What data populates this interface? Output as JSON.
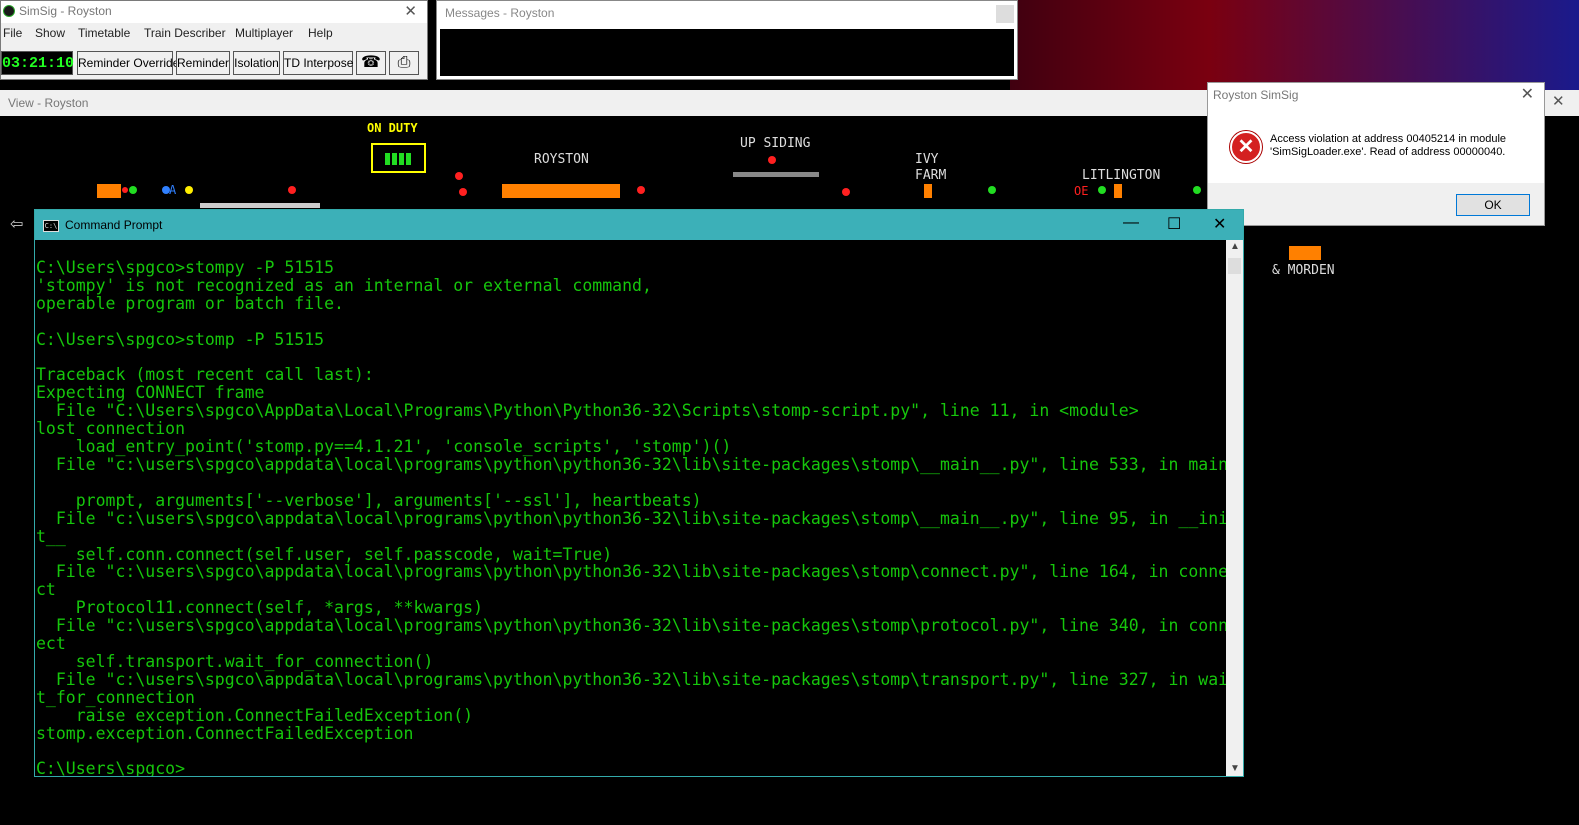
{
  "simsig": {
    "title": "SimSig - Royston",
    "close": "✕",
    "menu": [
      "File",
      "Show",
      "Timetable",
      "Train Describer",
      "Multiplayer",
      "Help"
    ],
    "clock": "03:21:10",
    "buttons": [
      "Reminder Override",
      "Reminder",
      "Isolation",
      "TD Interpose"
    ],
    "phone_icon": "☎",
    "print_icon": "⎙"
  },
  "messages": {
    "title": "Messages - Royston"
  },
  "view": {
    "title": "View - Royston",
    "close": "✕"
  },
  "panel": {
    "on_duty": "ON DUTY",
    "stations": {
      "royston": "ROYSTON",
      "up_siding": "UP SIDING",
      "ivy_farm_1": "IVY",
      "ivy_farm_2": "FARM",
      "litlington": "LITLINGTON",
      "morden": "& MORDEN"
    },
    "labels": {
      "a": "A",
      "oe": "OE"
    }
  },
  "error_dialog": {
    "title": "Royston SimSig",
    "close": "✕",
    "message": "Access violation at address 00405214 in module 'SimSigLoader.exe'. Read of address 00000040.",
    "ok": "OK"
  },
  "cmd": {
    "title": "Command Prompt",
    "minimize": "—",
    "maximize": "☐",
    "close": "✕",
    "output": "C:\\Users\\spgco>stompy -P 51515\n'stompy' is not recognized as an internal or external command,\noperable program or batch file.\n\nC:\\Users\\spgco>stomp -P 51515\n\nTraceback (most recent call last):\nExpecting CONNECT frame\n  File \"C:\\Users\\spgco\\AppData\\Local\\Programs\\Python\\Python36-32\\Scripts\\stomp-script.py\", line 11, in <module>\nlost connection\n    load_entry_point('stomp.py==4.1.21', 'console_scripts', 'stomp')()\n  File \"c:\\users\\spgco\\appdata\\local\\programs\\python\\python36-32\\lib\\site-packages\\stomp\\__main__.py\", line 533, in main\n\n    prompt, arguments['--verbose'], arguments['--ssl'], heartbeats)\n  File \"c:\\users\\spgco\\appdata\\local\\programs\\python\\python36-32\\lib\\site-packages\\stomp\\__main__.py\", line 95, in __ini\nt__\n    self.conn.connect(self.user, self.passcode, wait=True)\n  File \"c:\\users\\spgco\\appdata\\local\\programs\\python\\python36-32\\lib\\site-packages\\stomp\\connect.py\", line 164, in conne\nct\n    Protocol11.connect(self, *args, **kwargs)\n  File \"c:\\users\\spgco\\appdata\\local\\programs\\python\\python36-32\\lib\\site-packages\\stomp\\protocol.py\", line 340, in conn\nect\n    self.transport.wait_for_connection()\n  File \"c:\\users\\spgco\\appdata\\local\\programs\\python\\python36-32\\lib\\site-packages\\stomp\\transport.py\", line 327, in wai\nt_for_connection\n    raise exception.ConnectFailedException()\nstomp.exception.ConnectFailedException\n\nC:\\Users\\spgco>"
  },
  "colors": {
    "console_text": "#16c60c",
    "cmd_titlebar": "#3cb0b8",
    "track_occupied": "#ff8000",
    "signal_red": "#ff2020",
    "signal_green": "#22dd22",
    "on_duty_yellow": "#ffff00"
  }
}
